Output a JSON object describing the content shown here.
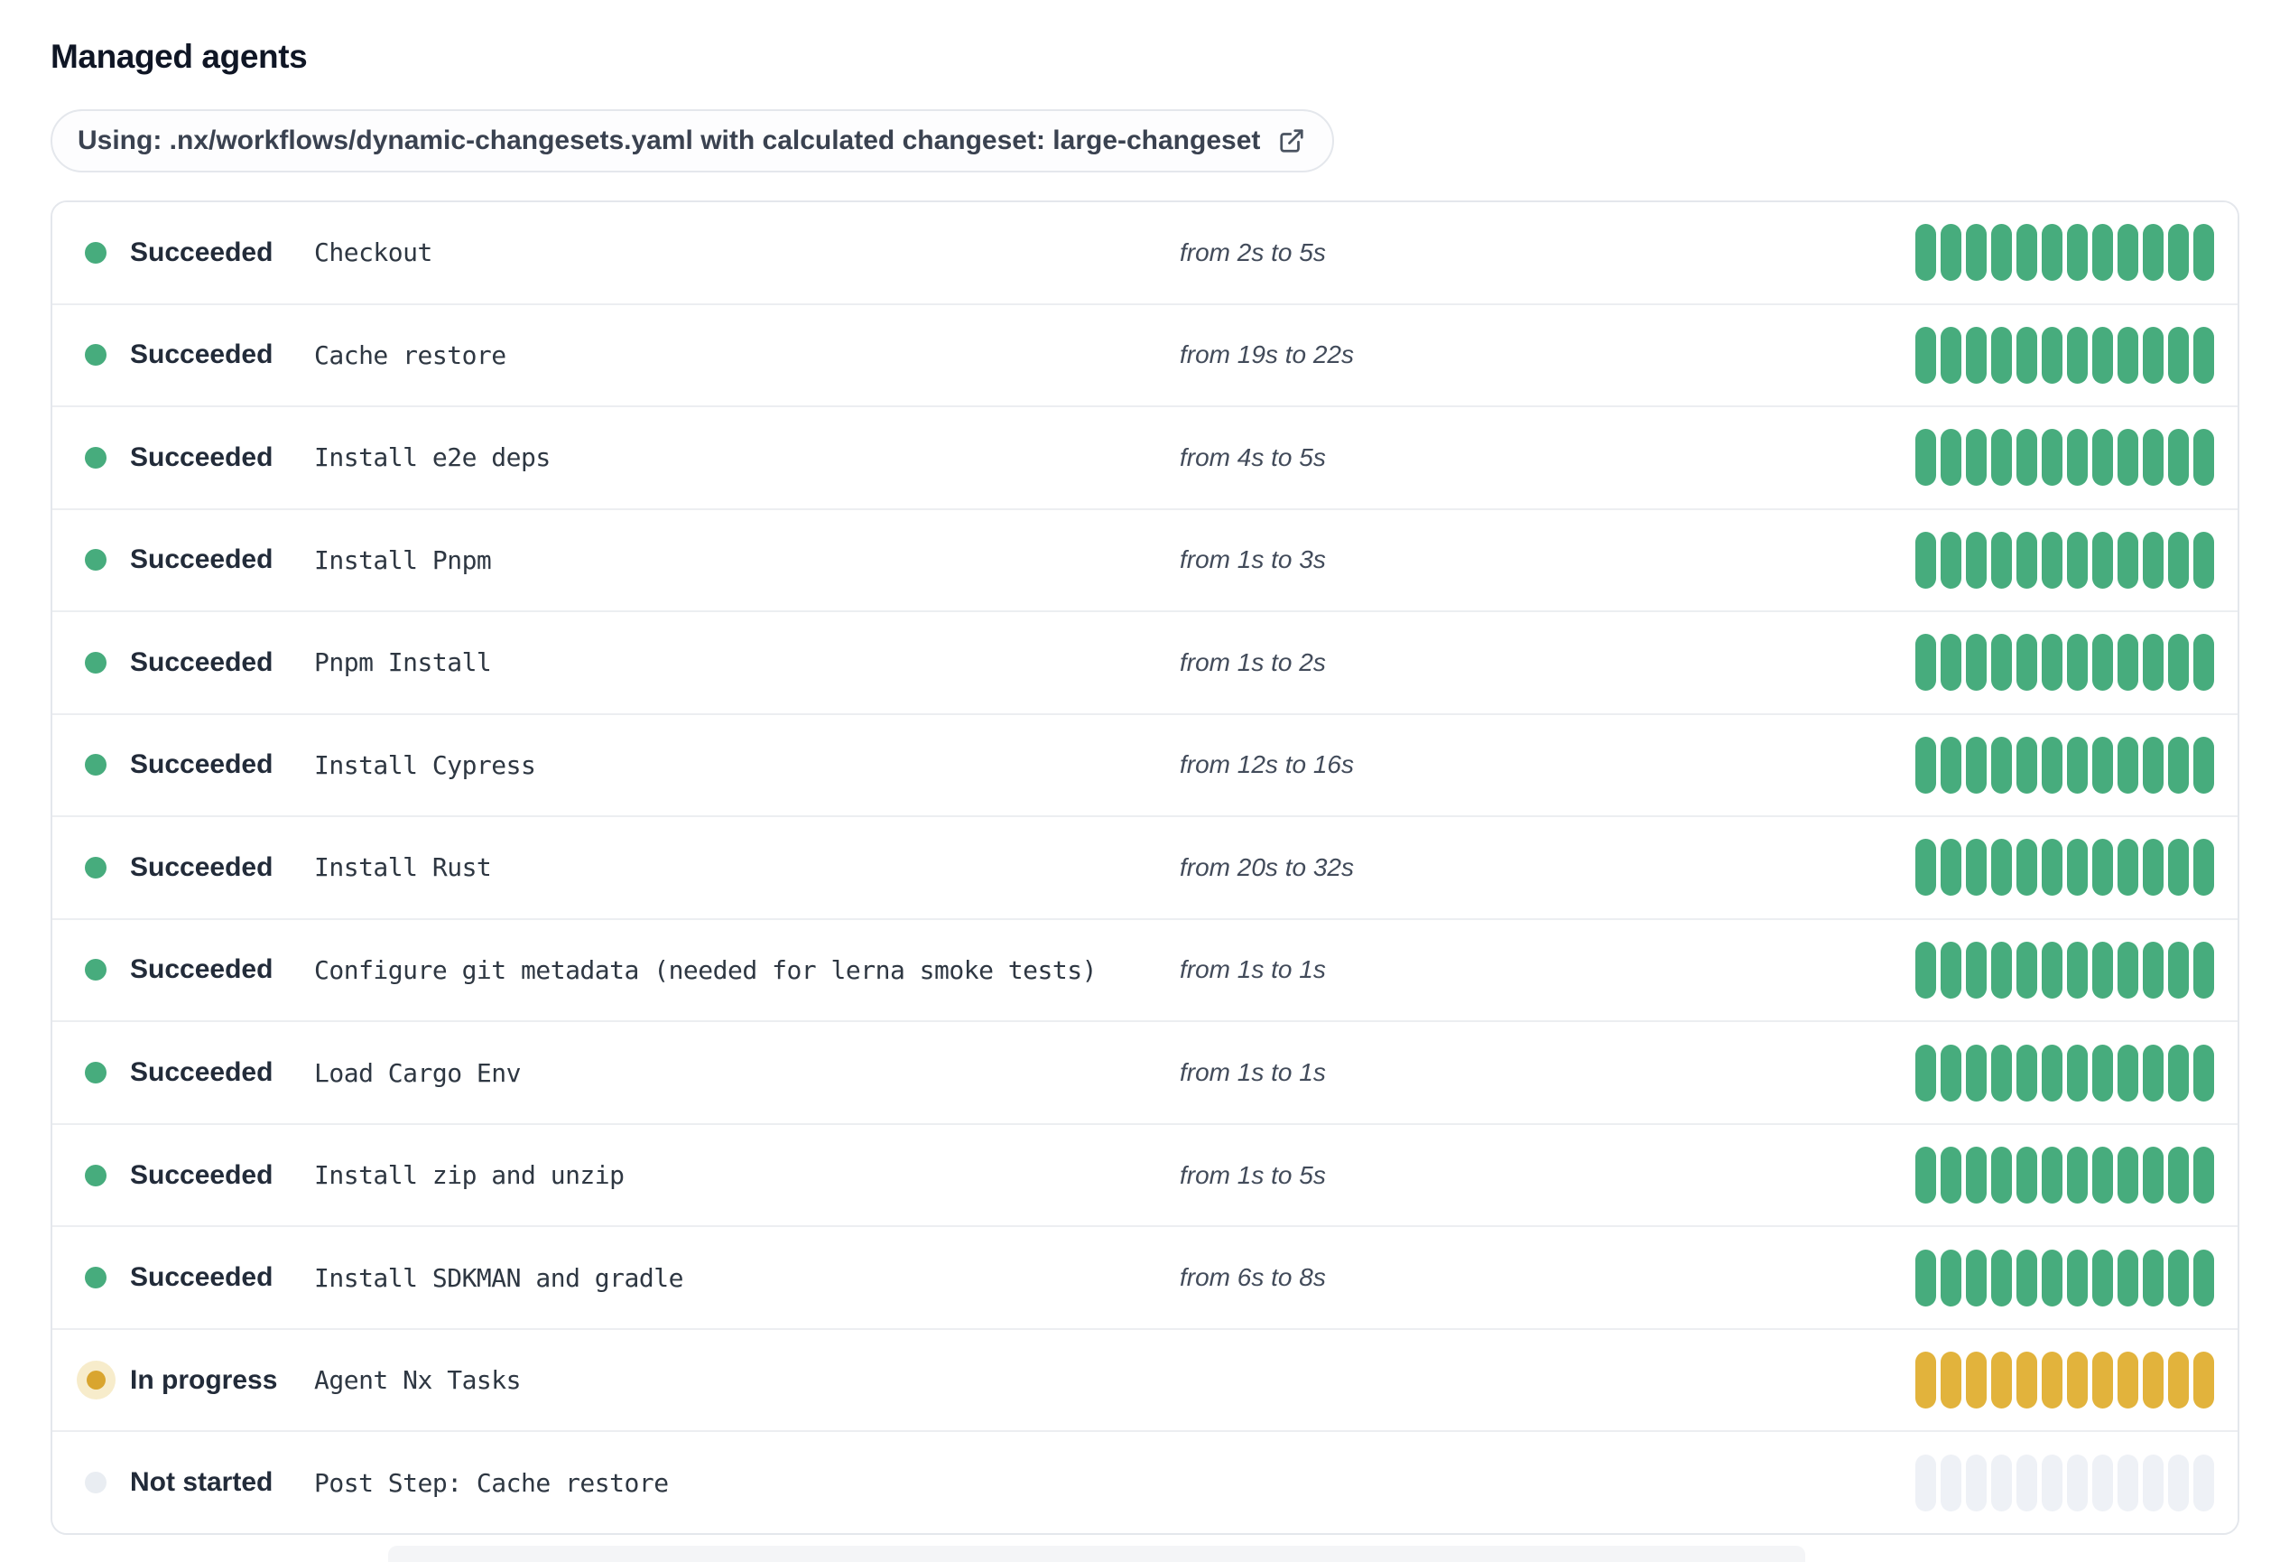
{
  "page_title": "Managed agents",
  "banner": {
    "label": "Using: .nx/workflows/dynamic-changesets.yaml with calculated changeset: large-changeset",
    "icon": "external-link-icon"
  },
  "progress_bar": {
    "segments_per_row": 12
  },
  "statuses": {
    "succeeded": {
      "label": "Succeeded",
      "dot_color": "#47ac7d",
      "bar_color": "#47ac7d"
    },
    "in_progress": {
      "label": "In progress",
      "dot_color": "#d9a52f",
      "bar_color": "#e2b33c"
    },
    "not_started": {
      "label": "Not started",
      "dot_color": "#e9edf2",
      "bar_color": "#eef1f6"
    }
  },
  "rows": [
    {
      "status": "succeeded",
      "step": "Checkout",
      "duration": "from 2s to 5s"
    },
    {
      "status": "succeeded",
      "step": "Cache restore",
      "duration": "from 19s to 22s"
    },
    {
      "status": "succeeded",
      "step": "Install e2e deps",
      "duration": "from 4s to 5s"
    },
    {
      "status": "succeeded",
      "step": "Install Pnpm",
      "duration": "from 1s to 3s"
    },
    {
      "status": "succeeded",
      "step": "Pnpm Install",
      "duration": "from 1s to 2s"
    },
    {
      "status": "succeeded",
      "step": "Install Cypress",
      "duration": "from 12s to 16s"
    },
    {
      "status": "succeeded",
      "step": "Install Rust",
      "duration": "from 20s to 32s"
    },
    {
      "status": "succeeded",
      "step": "Configure git metadata (needed for lerna smoke tests)",
      "duration": "from 1s to 1s"
    },
    {
      "status": "succeeded",
      "step": "Load Cargo Env",
      "duration": "from 1s to 1s"
    },
    {
      "status": "succeeded",
      "step": "Install zip and unzip",
      "duration": "from 1s to 5s"
    },
    {
      "status": "succeeded",
      "step": "Install SDKMAN and gradle",
      "duration": "from 6s to 8s"
    },
    {
      "status": "in_progress",
      "step": "Agent Nx Tasks",
      "duration": ""
    },
    {
      "status": "not_started",
      "step": "Post Step: Cache restore",
      "duration": ""
    }
  ]
}
